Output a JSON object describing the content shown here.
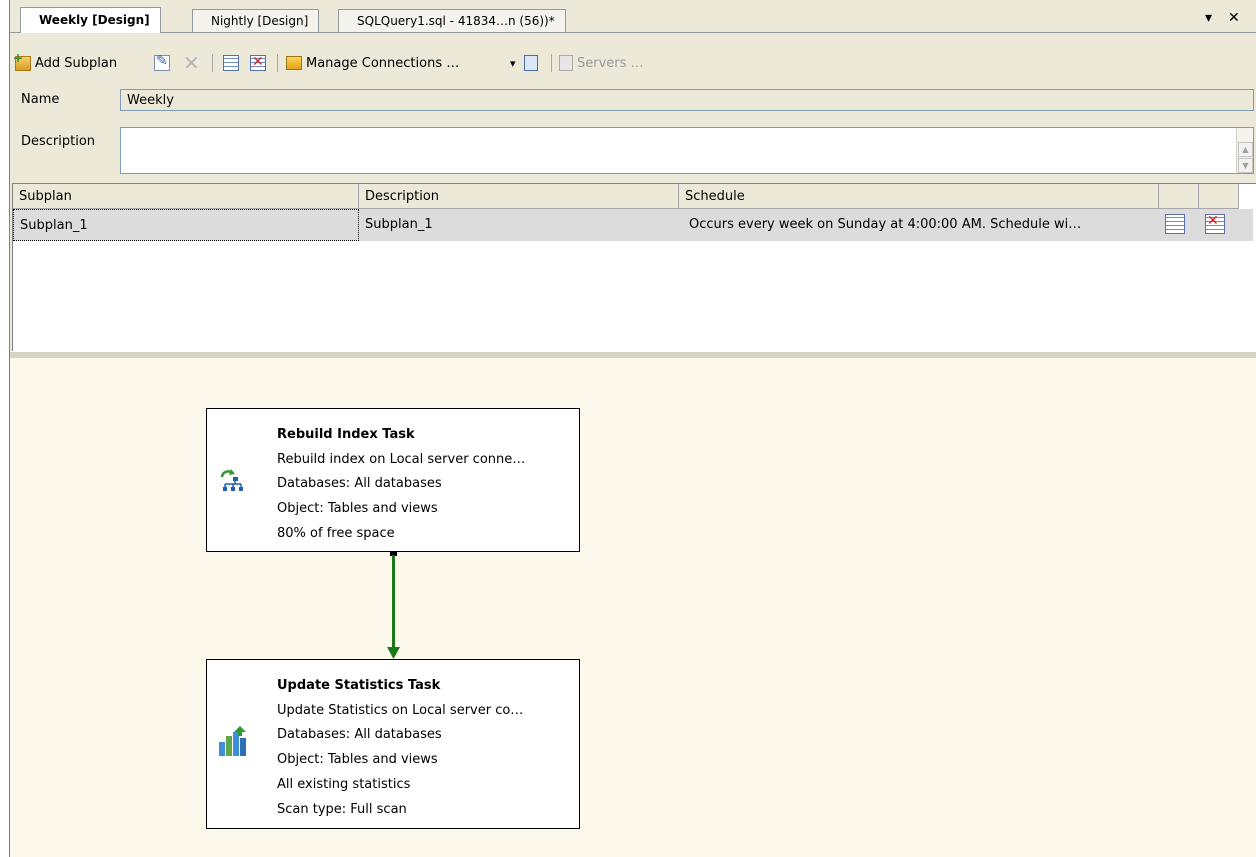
{
  "tabs": [
    {
      "label": "Weekly [Design]",
      "active": true
    },
    {
      "label": "Nightly [Design]",
      "active": false
    },
    {
      "label": "SQLQuery1.sql - 41834…n (56))*",
      "active": false
    }
  ],
  "tab_controls": {
    "dropdown": "▾",
    "close": "✕"
  },
  "toolbar": {
    "add_subplan": "Add Subplan",
    "manage_connections": "Manage Connections …",
    "servers": "Servers …",
    "dropdown_arrow": "▾"
  },
  "form": {
    "name_label": "Name",
    "name_value": "Weekly",
    "description_label": "Description",
    "description_value": ""
  },
  "subplan_grid": {
    "columns": [
      "Subplan",
      "Description",
      "Schedule"
    ],
    "rows": [
      {
        "subplan": "Subplan_1",
        "description": "Subplan_1",
        "schedule": "Occurs every week on Sunday at 4:00:00 AM. Schedule wi…"
      }
    ]
  },
  "tasks": [
    {
      "title": "Rebuild Index Task",
      "lines": [
        "Rebuild index on Local server conne…",
        "Databases: All databases",
        "Object: Tables and views",
        "80% of free space"
      ],
      "icon": "rebuild-index-icon"
    },
    {
      "title": "Update Statistics Task",
      "lines": [
        "Update Statistics on Local server co…",
        "Databases: All databases",
        "Object: Tables and views",
        "All existing statistics",
        "Scan type: Full scan"
      ],
      "icon": "update-statistics-icon"
    }
  ],
  "colors": {
    "connector": "#1a7a1a",
    "canvas": "#fcf9ec",
    "selected_row": "#dcdcdc"
  }
}
